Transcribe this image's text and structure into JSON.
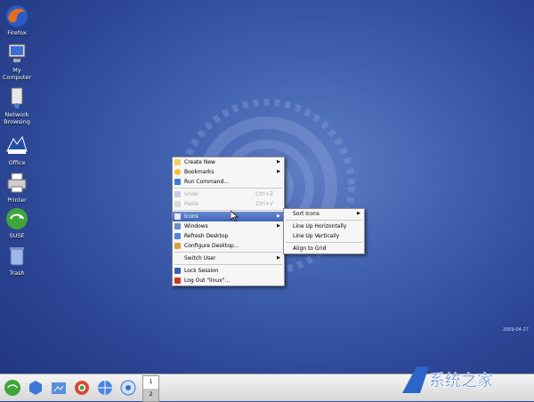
{
  "desktop_icons": [
    {
      "label": "Firefox",
      "icon": "firefox-icon"
    },
    {
      "label": "My\nComputer",
      "icon": "computer-icon"
    },
    {
      "label": "Network\nBrowsing",
      "icon": "network-icon"
    },
    {
      "label": "Office",
      "icon": "office-icon"
    },
    {
      "label": "Printer",
      "icon": "printer-icon"
    },
    {
      "label": "SUSE",
      "icon": "suse-icon"
    },
    {
      "label": "Trash",
      "icon": "trash-icon"
    }
  ],
  "context_menu": {
    "items": [
      {
        "label": "Create New",
        "submenu": true
      },
      {
        "label": "Bookmarks",
        "submenu": true
      },
      {
        "label": "Run Command..."
      },
      {
        "label": "Undo",
        "shortcut": "Ctrl+Z",
        "disabled": true
      },
      {
        "label": "Paste",
        "shortcut": "Ctrl+V",
        "disabled": true
      },
      {
        "label": "Icons",
        "submenu": true,
        "highlighted": true
      },
      {
        "label": "Windows",
        "submenu": true
      },
      {
        "label": "Refresh Desktop"
      },
      {
        "label": "Configure Desktop..."
      },
      {
        "label": "Switch User",
        "submenu": true
      },
      {
        "label": "Lock Session"
      },
      {
        "label": "Log Out \"linux\"..."
      }
    ]
  },
  "icons_submenu": {
    "items": [
      {
        "label": "Sort Icons",
        "submenu": true
      },
      {
        "label": "Line Up Horizontally"
      },
      {
        "label": "Line Up Vertically"
      },
      {
        "label": "Align to Grid"
      }
    ]
  },
  "taskbar": {
    "pager": [
      "1",
      "2"
    ],
    "clock_text": "2009-04-27"
  },
  "watermark": {
    "text": "系统之家"
  },
  "colors": {
    "desktop": "#2c4796",
    "highlight": "#4a6cc0"
  }
}
